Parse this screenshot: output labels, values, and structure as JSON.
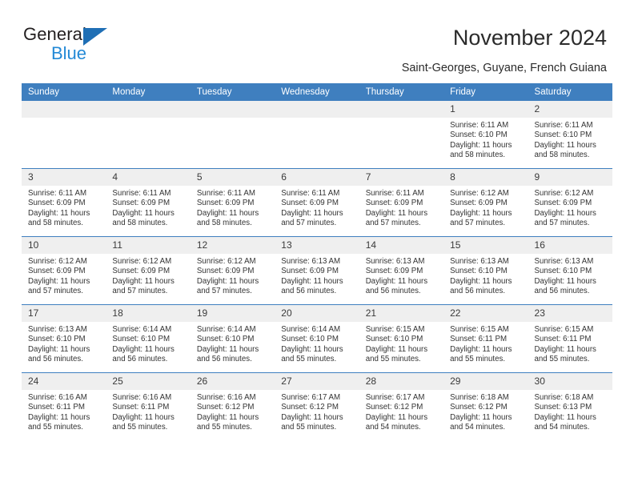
{
  "brand": {
    "name_top": "General",
    "name_bottom": "Blue",
    "triangle_color": "#1f6fb5",
    "blue_text_color": "#2389d6"
  },
  "header": {
    "title": "November 2024",
    "subtitle": "Saint-Georges, Guyane, French Guiana"
  },
  "theme": {
    "header_blue": "#3f7fbf",
    "daynum_band": "#efefef",
    "text": "#333333"
  },
  "weekdays": [
    "Sunday",
    "Monday",
    "Tuesday",
    "Wednesday",
    "Thursday",
    "Friday",
    "Saturday"
  ],
  "labels": {
    "sunrise_prefix": "Sunrise:",
    "sunset_prefix": "Sunset:",
    "daylight_prefix": "Daylight:"
  },
  "weeks": [
    [
      {
        "day": "",
        "empty": true
      },
      {
        "day": "",
        "empty": true
      },
      {
        "day": "",
        "empty": true
      },
      {
        "day": "",
        "empty": true
      },
      {
        "day": "",
        "empty": true
      },
      {
        "day": "1",
        "sunrise": "Sunrise: 6:11 AM",
        "sunset": "Sunset: 6:10 PM",
        "daylight": "Daylight: 11 hours and 58 minutes."
      },
      {
        "day": "2",
        "sunrise": "Sunrise: 6:11 AM",
        "sunset": "Sunset: 6:10 PM",
        "daylight": "Daylight: 11 hours and 58 minutes."
      }
    ],
    [
      {
        "day": "3",
        "sunrise": "Sunrise: 6:11 AM",
        "sunset": "Sunset: 6:09 PM",
        "daylight": "Daylight: 11 hours and 58 minutes."
      },
      {
        "day": "4",
        "sunrise": "Sunrise: 6:11 AM",
        "sunset": "Sunset: 6:09 PM",
        "daylight": "Daylight: 11 hours and 58 minutes."
      },
      {
        "day": "5",
        "sunrise": "Sunrise: 6:11 AM",
        "sunset": "Sunset: 6:09 PM",
        "daylight": "Daylight: 11 hours and 58 minutes."
      },
      {
        "day": "6",
        "sunrise": "Sunrise: 6:11 AM",
        "sunset": "Sunset: 6:09 PM",
        "daylight": "Daylight: 11 hours and 57 minutes."
      },
      {
        "day": "7",
        "sunrise": "Sunrise: 6:11 AM",
        "sunset": "Sunset: 6:09 PM",
        "daylight": "Daylight: 11 hours and 57 minutes."
      },
      {
        "day": "8",
        "sunrise": "Sunrise: 6:12 AM",
        "sunset": "Sunset: 6:09 PM",
        "daylight": "Daylight: 11 hours and 57 minutes."
      },
      {
        "day": "9",
        "sunrise": "Sunrise: 6:12 AM",
        "sunset": "Sunset: 6:09 PM",
        "daylight": "Daylight: 11 hours and 57 minutes."
      }
    ],
    [
      {
        "day": "10",
        "sunrise": "Sunrise: 6:12 AM",
        "sunset": "Sunset: 6:09 PM",
        "daylight": "Daylight: 11 hours and 57 minutes."
      },
      {
        "day": "11",
        "sunrise": "Sunrise: 6:12 AM",
        "sunset": "Sunset: 6:09 PM",
        "daylight": "Daylight: 11 hours and 57 minutes."
      },
      {
        "day": "12",
        "sunrise": "Sunrise: 6:12 AM",
        "sunset": "Sunset: 6:09 PM",
        "daylight": "Daylight: 11 hours and 57 minutes."
      },
      {
        "day": "13",
        "sunrise": "Sunrise: 6:13 AM",
        "sunset": "Sunset: 6:09 PM",
        "daylight": "Daylight: 11 hours and 56 minutes."
      },
      {
        "day": "14",
        "sunrise": "Sunrise: 6:13 AM",
        "sunset": "Sunset: 6:09 PM",
        "daylight": "Daylight: 11 hours and 56 minutes."
      },
      {
        "day": "15",
        "sunrise": "Sunrise: 6:13 AM",
        "sunset": "Sunset: 6:10 PM",
        "daylight": "Daylight: 11 hours and 56 minutes."
      },
      {
        "day": "16",
        "sunrise": "Sunrise: 6:13 AM",
        "sunset": "Sunset: 6:10 PM",
        "daylight": "Daylight: 11 hours and 56 minutes."
      }
    ],
    [
      {
        "day": "17",
        "sunrise": "Sunrise: 6:13 AM",
        "sunset": "Sunset: 6:10 PM",
        "daylight": "Daylight: 11 hours and 56 minutes."
      },
      {
        "day": "18",
        "sunrise": "Sunrise: 6:14 AM",
        "sunset": "Sunset: 6:10 PM",
        "daylight": "Daylight: 11 hours and 56 minutes."
      },
      {
        "day": "19",
        "sunrise": "Sunrise: 6:14 AM",
        "sunset": "Sunset: 6:10 PM",
        "daylight": "Daylight: 11 hours and 56 minutes."
      },
      {
        "day": "20",
        "sunrise": "Sunrise: 6:14 AM",
        "sunset": "Sunset: 6:10 PM",
        "daylight": "Daylight: 11 hours and 55 minutes."
      },
      {
        "day": "21",
        "sunrise": "Sunrise: 6:15 AM",
        "sunset": "Sunset: 6:10 PM",
        "daylight": "Daylight: 11 hours and 55 minutes."
      },
      {
        "day": "22",
        "sunrise": "Sunrise: 6:15 AM",
        "sunset": "Sunset: 6:11 PM",
        "daylight": "Daylight: 11 hours and 55 minutes."
      },
      {
        "day": "23",
        "sunrise": "Sunrise: 6:15 AM",
        "sunset": "Sunset: 6:11 PM",
        "daylight": "Daylight: 11 hours and 55 minutes."
      }
    ],
    [
      {
        "day": "24",
        "sunrise": "Sunrise: 6:16 AM",
        "sunset": "Sunset: 6:11 PM",
        "daylight": "Daylight: 11 hours and 55 minutes."
      },
      {
        "day": "25",
        "sunrise": "Sunrise: 6:16 AM",
        "sunset": "Sunset: 6:11 PM",
        "daylight": "Daylight: 11 hours and 55 minutes."
      },
      {
        "day": "26",
        "sunrise": "Sunrise: 6:16 AM",
        "sunset": "Sunset: 6:12 PM",
        "daylight": "Daylight: 11 hours and 55 minutes."
      },
      {
        "day": "27",
        "sunrise": "Sunrise: 6:17 AM",
        "sunset": "Sunset: 6:12 PM",
        "daylight": "Daylight: 11 hours and 55 minutes."
      },
      {
        "day": "28",
        "sunrise": "Sunrise: 6:17 AM",
        "sunset": "Sunset: 6:12 PM",
        "daylight": "Daylight: 11 hours and 54 minutes."
      },
      {
        "day": "29",
        "sunrise": "Sunrise: 6:18 AM",
        "sunset": "Sunset: 6:12 PM",
        "daylight": "Daylight: 11 hours and 54 minutes."
      },
      {
        "day": "30",
        "sunrise": "Sunrise: 6:18 AM",
        "sunset": "Sunset: 6:13 PM",
        "daylight": "Daylight: 11 hours and 54 minutes."
      }
    ]
  ]
}
